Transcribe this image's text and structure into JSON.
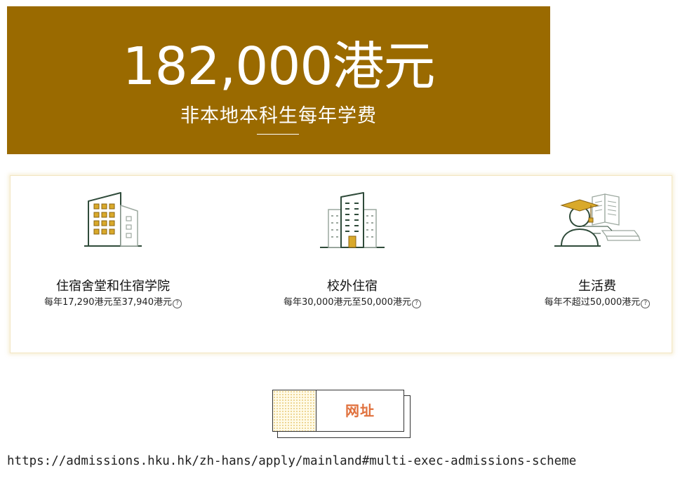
{
  "banner": {
    "amount": "182,000港元",
    "subtitle": "非本地本科生每年学费",
    "background_color": "#9a6a00"
  },
  "costs": [
    {
      "icon": "building-icon",
      "title": "住宿舍堂和住宿学院",
      "description": "每年17,290港元至37,940港元"
    },
    {
      "icon": "skyscraper-icon",
      "title": "校外住宿",
      "description": "每年30,000港元至50,000港元"
    },
    {
      "icon": "graduate-icon",
      "title": "生活费",
      "description": "每年不超过50,000港元"
    }
  ],
  "help_glyph": "?",
  "website_button": {
    "label": "网址",
    "label_color": "#e0703c"
  },
  "url": "https://admissions.hku.hk/zh-hans/apply/mainland#multi-exec-admissions-scheme"
}
